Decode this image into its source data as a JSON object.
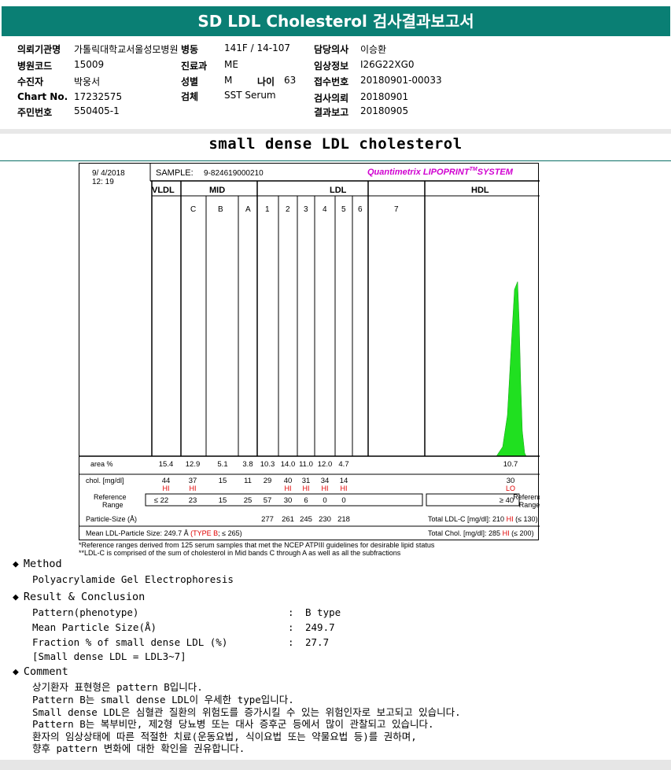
{
  "title": "SD LDL Cholesterol 검사결과보고서",
  "info": [
    {
      "label": "의뢰기관명",
      "value": "가톨릭대학교서울성모병원"
    },
    {
      "label": "병원코드",
      "value": "15009"
    },
    {
      "label": "수진자",
      "value": "박웅서"
    },
    {
      "label": "Chart No.",
      "value": "17232575"
    },
    {
      "label": "주민번호",
      "value": "550405-1"
    },
    {
      "label": "병동",
      "value": "141F / 14-107"
    },
    {
      "label": "진료과",
      "value": "ME"
    },
    {
      "label": "성별",
      "value": "M"
    },
    {
      "label": "나이",
      "value": "63"
    },
    {
      "label": "검체",
      "value": "SST Serum"
    },
    {
      "label": "담당의사",
      "value": "이승환"
    },
    {
      "label": "임상정보",
      "value": "I26G22XG0"
    },
    {
      "label": "접수번호",
      "value": "20180901-00033"
    },
    {
      "label": "검사의뢰",
      "value": "20180901"
    },
    {
      "label": "결과보고",
      "value": "20180905"
    }
  ],
  "section_title": "small dense LDL cholesterol",
  "report": {
    "date": "9/ 4/2018",
    "time": "12: 19",
    "sample_label": "SAMPLE:",
    "sample_id": "9-824619000210",
    "brand_pre": "Quantimetrix LIPOPRINT",
    "brand_tm": "TM",
    "brand_post": "SYSTEM",
    "groups": [
      "VLDL",
      "MID",
      "LDL",
      "HDL"
    ],
    "mid_bands": [
      "C",
      "B",
      "A"
    ],
    "ldl_bands": [
      "1",
      "2",
      "3",
      "4",
      "5",
      "6",
      "7"
    ],
    "row_labels": {
      "area": "area %",
      "chol": "chol. [mg/dl]",
      "ref1": "Reference",
      "ref2": "Range",
      "psize": "Particle-Size (Å)",
      "mean_size": "Mean LDL-Particle Size:"
    },
    "area": [
      "15.4",
      "12.9",
      "5.1",
      "3.8",
      "10.3",
      "14.0",
      "11.0",
      "12.0",
      "4.7",
      "10.7"
    ],
    "chol": [
      "44",
      "37",
      "15",
      "11",
      "29",
      "40",
      "31",
      "34",
      "14",
      "30"
    ],
    "chol_flag": [
      "HI",
      "HI",
      "",
      "",
      "",
      "HI",
      "HI",
      "HI",
      "HI",
      "LO"
    ],
    "ref": [
      "≤ 22",
      "23",
      "15",
      "25",
      "57",
      "30",
      "6",
      "0",
      "0",
      "≥ 40"
    ],
    "psize": [
      "277",
      "261",
      "245",
      "230",
      "218"
    ],
    "mean_size_value": "249.7 Å",
    "mean_size_type": "(TYPE B",
    "mean_size_ref": "; ≤ 265)",
    "total_ldl_label": "Total LDL-C [mg/dl]:",
    "total_ldl_value": "210",
    "total_ldl_flag": "HI",
    "total_ldl_ref": "(≤ 130)",
    "total_chol_label": "Total Chol. [mg/dl]:",
    "total_chol_value": "285",
    "total_chol_flag": "HI",
    "total_chol_ref": "(≤ 200)",
    "hdl_ref1": "Reference",
    "hdl_ref2": "Range"
  },
  "footnotes": [
    "*Reference ranges derived from 125 serum samples that met the NCEP ATPIII guidelines for desirable lipid status",
    "**LDL-C is comprised of the sum of cholesterol in Mid bands C through A as well as all the subfractions"
  ],
  "method": {
    "heading": "Method",
    "text": "Polyacrylamide Gel Electrophoresis"
  },
  "result": {
    "heading": "Result & Conclusion",
    "rows": [
      {
        "label": "Pattern(phenotype)",
        "value": "B type"
      },
      {
        "label": "Mean Particle Size(Å)",
        "value": "249.7"
      },
      {
        "label": "Fraction % of small dense LDL (%)",
        "value": "27.7"
      }
    ],
    "note": "[Small dense LDL = LDL3~7]",
    "colon": ":"
  },
  "comment": {
    "heading": "Comment",
    "lines": [
      "상기환자 표현형은 pattern B입니다.",
      "Pattern B는 small dense LDL이 우세한 type입니다.",
      "Small dense LDL은 심혈관 질환의 위험도를 증가시킬 수 있는 위험인자로 보고되고 있습니다.",
      "Pattern B는 복부비만, 제2형 당뇨병 또는 대사 증후군 등에서 많이 관찰되고 있습니다.",
      "환자의 임상상태에 따른 적절한 치료(운동요법, 식이요법 또는 약물요법 등)를 권하며,",
      "향후 pattern 변화에 대한 확인을 권유합니다."
    ]
  },
  "colors": {
    "title_bg": "#0a7f74",
    "flag": "#e00000",
    "brand": "#d000d0",
    "type_b": "#e00000"
  }
}
